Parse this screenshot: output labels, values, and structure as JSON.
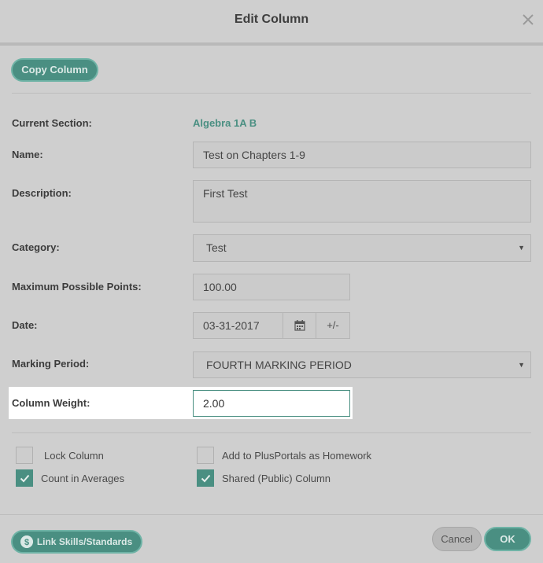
{
  "dialog": {
    "title": "Edit Column"
  },
  "toolbar": {
    "copy_label": "Copy Column"
  },
  "form": {
    "current_section": {
      "label": "Current Section:",
      "value": "Algebra 1A B"
    },
    "name": {
      "label": "Name:",
      "value": "Test on Chapters 1-9"
    },
    "description": {
      "label": "Description:",
      "value": "First Test"
    },
    "category": {
      "label": "Category:",
      "value": "Test"
    },
    "max_points": {
      "label": "Maximum Possible Points:",
      "value": "100.00"
    },
    "date": {
      "label": "Date:",
      "value": "03-31-2017",
      "adjust_label": "+/-"
    },
    "marking_period": {
      "label": "Marking Period:",
      "value": "FOURTH MARKING PERIOD"
    },
    "column_weight": {
      "label": "Column Weight:",
      "value": "2.00"
    }
  },
  "options": {
    "lock_column": {
      "label": "Lock Column",
      "checked": false
    },
    "count_in_averages": {
      "label": "Count in Averages",
      "checked": true
    },
    "add_to_plusportals": {
      "label": "Add to PlusPortals as Homework",
      "checked": false
    },
    "shared_public": {
      "label": "Shared (Public) Column",
      "checked": true
    }
  },
  "footer": {
    "link_skills_label": "Link Skills/Standards",
    "cancel_label": "Cancel",
    "ok_label": "OK"
  },
  "icons": {
    "close": "close-icon",
    "calendar": "calendar-icon",
    "caret": "caret-down-icon",
    "check": "checkmark-icon",
    "badge": "badge-icon"
  },
  "colors": {
    "accent": "#4a8f82",
    "overlay": "#cfcfcf",
    "highlight": "#ffffff"
  }
}
